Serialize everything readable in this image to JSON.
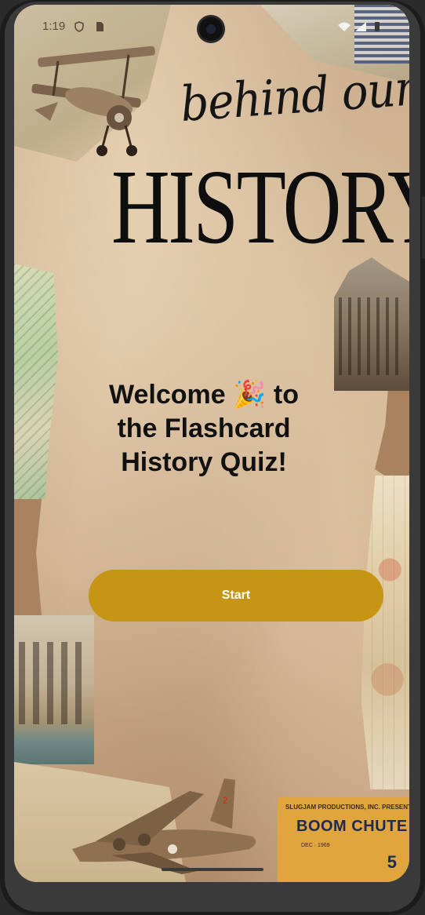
{
  "status_bar": {
    "time": "1:19",
    "icons_left": [
      "shield-icon",
      "sim-card-icon"
    ],
    "icons_right": [
      "wifi-icon",
      "signal-icon",
      "battery-icon"
    ]
  },
  "header": {
    "script_title": "behind our",
    "main_title": "HISTORY"
  },
  "main": {
    "welcome_text": "Welcome 🎉 to the Flashcard History Quiz!",
    "start_label": "Start"
  },
  "decor": {
    "ticket_presents": "SLUGJAM PRODUCTIONS, INC. PRESENTS",
    "ticket_title": "BOOM CHUTE",
    "ticket_detail": "DEC · 1969",
    "ticket_year": "5",
    "plane_tail_number": "2"
  },
  "colors": {
    "button_bg": "#c69514",
    "button_text": "#ffffff",
    "paper_bg": "#c9a986",
    "title_text": "#0e0e0e"
  }
}
